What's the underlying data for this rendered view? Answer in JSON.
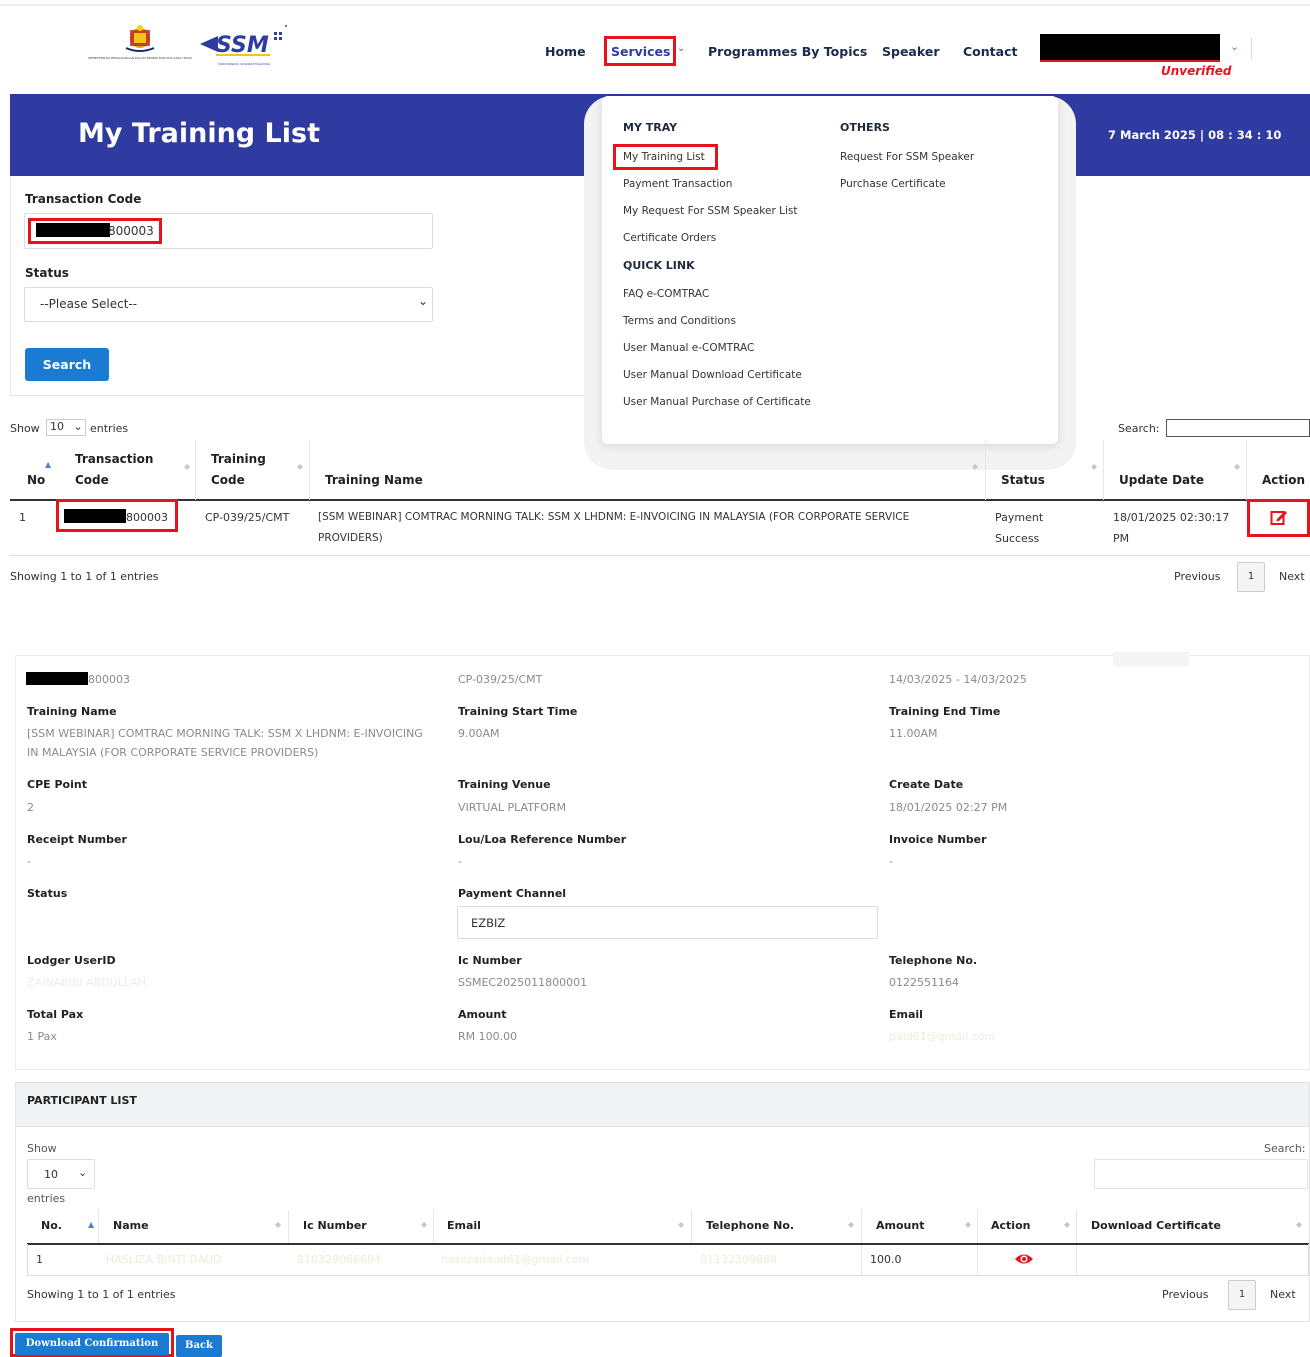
{
  "header": {
    "ministry_logo_text": "KEMENTERIAN PERDAGANGAN DALAM NEGERI DAN KOS SARA HIDUP",
    "ssm_logo_text": "SURUHANJAYA SYARIKAT MALAYSIA",
    "nav": {
      "home": "Home",
      "services": "Services",
      "programmes": "Programmes By Topics",
      "speaker": "Speaker",
      "contact": "Contact"
    },
    "user_status": "Unverified"
  },
  "banner": {
    "title": "My Training List",
    "datetime": "7 March 2025 | 08 : 34 : 10"
  },
  "dropdown": {
    "mytray_heading": "MY TRAY",
    "mytray_items": [
      "My Training List",
      "Payment Transaction",
      "My Request For SSM Speaker List",
      "Certificate Orders"
    ],
    "quicklink_heading": "QUICK LINK",
    "quicklink_items": [
      "FAQ e-COMTRAC",
      "Terms and Conditions",
      "User Manual e-COMTRAC",
      "User Manual Download Certificate",
      "User Manual Purchase of Certificate"
    ],
    "others_heading": "OTHERS",
    "others_items": [
      "Request For SSM Speaker",
      "Purchase Certificate"
    ]
  },
  "filter": {
    "transaction_code_label": "Transaction Code",
    "transaction_code_value": "800003",
    "status_label": "Status",
    "status_value": "--Please Select--",
    "search_button": "Search"
  },
  "table": {
    "show_label": "Show",
    "entries_value": "10",
    "entries_label": "entries",
    "search_label": "Search:",
    "headers": {
      "no": "No",
      "transaction_code_1": "Transaction",
      "transaction_code_2": "Code",
      "training_code_1": "Training",
      "training_code_2": "Code",
      "training_name": "Training Name",
      "status": "Status",
      "update_date": "Update Date",
      "action": "Action"
    },
    "row": {
      "no": "1",
      "transaction_code": "800003",
      "training_code": "CP-039/25/CMT",
      "training_name_1": "[SSM WEBINAR] COMTRAC MORNING TALK: SSM X LHDNM: E-INVOICING IN MALAYSIA (FOR CORPORATE SERVICE",
      "training_name_2": "PROVIDERS)",
      "status_1": "Payment",
      "status_2": "Success",
      "update_date_1": "18/01/2025 02:30:17",
      "update_date_2": "PM"
    },
    "showing": "Showing 1 to 1 of 1 entries",
    "previous": "Previous",
    "page": "1",
    "next": "Next"
  },
  "details": {
    "transaction_code": "800003",
    "training_code": "CP-039/25/CMT",
    "date_range": "14/03/2025 - 14/03/2025",
    "training_name_label": "Training Name",
    "training_name_1": "[SSM WEBINAR] COMTRAC MORNING TALK: SSM X LHDNM: E-INVOICING",
    "training_name_2": "IN MALAYSIA (FOR CORPORATE SERVICE PROVIDERS)",
    "start_time_label": "Training Start Time",
    "start_time": "9.00AM",
    "end_time_label": "Training End Time",
    "end_time": "11.00AM",
    "cpe_label": "CPE Point",
    "cpe": "2",
    "venue_label": "Training Venue",
    "venue": "VIRTUAL PLATFORM",
    "create_date_label": "Create Date",
    "create_date": "18/01/2025 02:27 PM",
    "receipt_label": "Receipt Number",
    "receipt": "-",
    "lou_label": "Lou/Loa Reference Number",
    "lou": "-",
    "invoice_label": "Invoice Number",
    "invoice": "-",
    "status_label": "Status",
    "payment_channel_label": "Payment Channel",
    "payment_channel": "EZBIZ",
    "lodger_label": "Lodger UserID",
    "lodger": "ZAINABIBI ABDULLAH",
    "ic_label": "Ic Number",
    "ic": "SSMEC2025011800001",
    "tel_label": "Telephone No.",
    "tel": "0122551164",
    "pax_label": "Total Pax",
    "pax": "1 Pax",
    "amount_label": "Amount",
    "amount": "RM 100.00",
    "email_label": "Email",
    "email": "paid61@gmail.com"
  },
  "participants": {
    "title": "PARTICIPANT LIST",
    "show_label": "Show",
    "entries_value": "10",
    "entries_label": "entries",
    "search_label": "Search:",
    "headers": {
      "no": "No.",
      "name": "Name",
      "ic": "Ic Number",
      "email": "Email",
      "tel": "Telephone No.",
      "amount": "Amount",
      "action": "Action",
      "download": "Download Certificate"
    },
    "row": {
      "no": "1",
      "name": "HASLIZA BINTI DAUD",
      "ic": "810329066604",
      "email": "haslizadaud61@gmail.com",
      "tel": "01132309888",
      "amount": "100.0"
    },
    "showing": "Showing 1 to 1 of 1 entries",
    "previous": "Previous",
    "page": "1",
    "next": "Next"
  },
  "buttons": {
    "download_slip": "Download Confirmation Slip",
    "back": "Back"
  },
  "colors": {
    "banner": "#2f3ba0",
    "primary_button": "#1b7bd3",
    "highlight": "#e8121c"
  }
}
